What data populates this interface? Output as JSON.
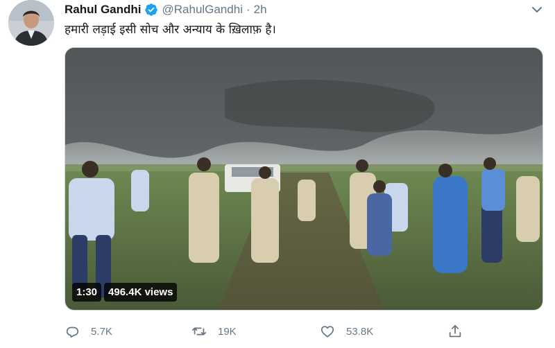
{
  "tweet": {
    "author_name": "Rahul Gandhi",
    "handle": "@RahulGandhi",
    "separator": "·",
    "time": "2h",
    "text": "हमारी लड़ाई इसी सोच और अन्याय के ख़िलाफ़ है।"
  },
  "media": {
    "duration": "1:30",
    "views": "496.4K views"
  },
  "actions": {
    "replies": "5.7K",
    "retweets": "19K",
    "likes": "53.8K"
  },
  "colors": {
    "text_primary": "#14171a",
    "text_secondary": "#657786",
    "verified_blue": "#1da1f2"
  },
  "icons": {
    "verified": "verified-badge-icon",
    "menu": "chevron-down-icon",
    "reply": "reply-icon",
    "retweet": "retweet-icon",
    "like": "heart-icon",
    "share": "share-icon"
  }
}
